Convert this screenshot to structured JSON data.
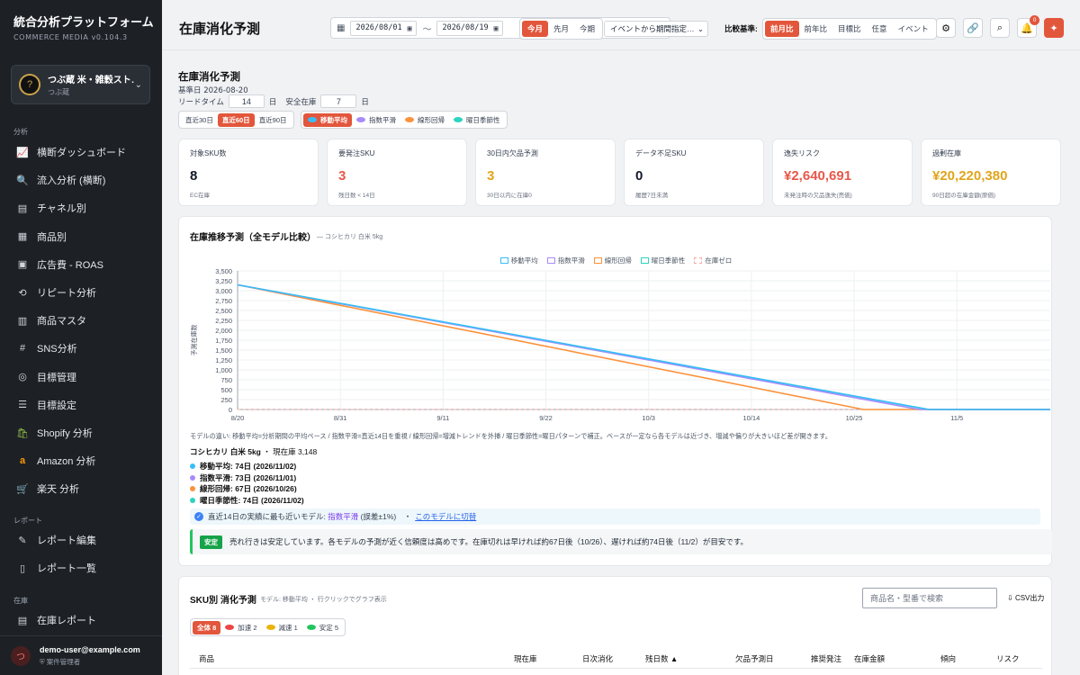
{
  "brand": {
    "title": "統合分析プラットフォーム",
    "subtitle": "COMMERCE MEDIA  v0.104.3"
  },
  "store": {
    "avatar": "?",
    "name": "つぶ蔵 米・雑穀スト…",
    "sub": "つぶ蔵"
  },
  "sidebar": {
    "section_analysis": "分析",
    "items": [
      {
        "label": "横断ダッシュボード",
        "icon": "line-chart-icon",
        "glyph": "📈"
      },
      {
        "label": "流入分析 (横断)",
        "icon": "search-icon",
        "glyph": "🔍"
      },
      {
        "label": "チャネル別",
        "icon": "archive-icon",
        "glyph": "▤"
      },
      {
        "label": "商品別",
        "icon": "boxes-icon",
        "glyph": "▦"
      },
      {
        "label": "広告費 - ROAS",
        "icon": "ad-icon",
        "glyph": "▣"
      },
      {
        "label": "リピート分析",
        "icon": "repeat-icon",
        "glyph": "⟲"
      },
      {
        "label": "商品マスタ",
        "icon": "calendar-icon",
        "glyph": "▥"
      },
      {
        "label": "SNS分析",
        "icon": "hash-icon",
        "glyph": "#"
      },
      {
        "label": "目標管理",
        "icon": "target-icon",
        "glyph": "◎"
      },
      {
        "label": "目標設定",
        "icon": "sliders-icon",
        "glyph": "☰"
      },
      {
        "label": "Shopify 分析",
        "icon": "shopify-icon",
        "glyph": "🛍"
      },
      {
        "label": "Amazon 分析",
        "icon": "amazon-icon",
        "glyph": "a"
      },
      {
        "label": "楽天 分析",
        "icon": "rakuten-cart-icon",
        "glyph": "🛒"
      }
    ],
    "section_report": "レポート",
    "report_items": [
      {
        "label": "レポート編集",
        "icon": "edit-icon",
        "glyph": "✎"
      },
      {
        "label": "レポート一覧",
        "icon": "document-icon",
        "glyph": "▯"
      }
    ],
    "section_stock": "在庫",
    "stock_items": [
      {
        "label": "在庫レポート",
        "icon": "warehouse-icon",
        "glyph": "▤"
      }
    ]
  },
  "user": {
    "avatar": "つ",
    "email": "demo-user@example.com",
    "role": "案件管理者"
  },
  "header": {
    "title": "在庫消化予測",
    "date_from": "2026/08/01",
    "date_to": "2026/08/19",
    "tilde": "〜",
    "period_tabs": [
      "今月",
      "先月",
      "今期"
    ],
    "period_active": 0,
    "event_select": "イベントから期間指定…",
    "compare_label": "比較基準:",
    "compare_tabs": [
      "前月比",
      "前年比",
      "目標比",
      "任意",
      "イベント"
    ],
    "compare_active": 0,
    "notif_count": "0"
  },
  "section": {
    "title": "在庫消化予測",
    "base_date": "基準日 2026-08-20",
    "lead_label": "リードタイム",
    "lead_value": "14",
    "lead_unit": "日",
    "safety_label": "安全在庫",
    "safety_value": "7",
    "safety_unit": "日",
    "range_tabs": [
      "直近30日",
      "直近60日",
      "直近90日"
    ],
    "range_active": 1,
    "model_tabs": [
      {
        "label": "移動平均",
        "color": "#38bdf8"
      },
      {
        "label": "指数平滑",
        "color": "#a78bfa"
      },
      {
        "label": "線形回帰",
        "color": "#fb923c"
      },
      {
        "label": "曜日季節性",
        "color": "#2dd4bf"
      }
    ],
    "model_active": 0
  },
  "kpis": [
    {
      "label": "対象SKU数",
      "value": "8",
      "note": "EC在庫",
      "color": "#111827"
    },
    {
      "label": "要発注SKU",
      "value": "3",
      "note": "残日数 < 14日",
      "color": "#e8584a"
    },
    {
      "label": "30日内欠品予測",
      "value": "3",
      "note": "30日以内に在庫0",
      "color": "#e0a51c"
    },
    {
      "label": "データ不足SKU",
      "value": "0",
      "note": "履歴7日未満",
      "color": "#111827"
    },
    {
      "label": "逸失リスク",
      "value": "¥2,640,691",
      "note": "未発注時の欠品逸失(売価)",
      "color": "#e8584a"
    },
    {
      "label": "過剰在庫",
      "value": "¥20,220,380",
      "note": "90日超の在庫金額(原価)",
      "color": "#e0a51c"
    }
  ],
  "chart_card": {
    "title": "在庫推移予測（全モデル比較）",
    "subtitle": "— コシヒカリ 白米 5kg",
    "description": "モデルの違い: 移動平均=分析期間の平均ペース / 指数平滑=直近14日を重視 / 線形回帰=増減トレンドを外挿 / 曜日季節性=曜日パターンで補正。ペースが一定なら各モデルは近づき、増減や偏りが大きいほど差が開きます。",
    "sku_name": "コシヒカリ 白米 5kg",
    "sku_stock": "・ 現在庫 3,148",
    "model_results": [
      {
        "label": "移動平均: 74日 (2026/11/02)",
        "color": "#38bdf8"
      },
      {
        "label": "指数平滑: 73日 (2026/11/01)",
        "color": "#a78bfa"
      },
      {
        "label": "線形回帰: 67日 (2026/10/26)",
        "color": "#fb923c"
      },
      {
        "label": "曜日季節性: 74日 (2026/11/02)",
        "color": "#2dd4bf"
      }
    ],
    "info_prefix": "直近14日の実績に最も近いモデル:",
    "info_model": "指数平滑",
    "info_suffix": "(誤差±1%)　・",
    "info_link": "このモデルに切替",
    "stable_badge": "安定",
    "stable_text": "売れ行きは安定しています。各モデルの予測が近く信頼度は高めです。在庫切れは早ければ約67日後（10/26）、遅ければ約74日後（11/2）が目安です。"
  },
  "chart_data": {
    "type": "line",
    "title": "在庫推移予測（全モデル比較）",
    "xlabel": "",
    "ylabel": "予測在庫数",
    "ylim": [
      0,
      3500
    ],
    "yticks": [
      "0",
      "250",
      "500",
      "750",
      "1,000",
      "1,250",
      "1,500",
      "1,750",
      "2,000",
      "2,250",
      "2,500",
      "2,750",
      "3,000",
      "3,250",
      "3,500"
    ],
    "xticks": [
      "8/20",
      "8/31",
      "9/11",
      "9/22",
      "10/3",
      "10/14",
      "10/25",
      "11/5"
    ],
    "x_start": "2026-08-20",
    "x_end": "2026-11-15",
    "series": [
      {
        "name": "移動平均",
        "color": "#38bdf8",
        "points": [
          [
            "2026-08-20",
            3148
          ],
          [
            "2026-11-02",
            0
          ],
          [
            "2026-11-15",
            0
          ]
        ]
      },
      {
        "name": "指数平滑",
        "color": "#a78bfa",
        "points": [
          [
            "2026-08-20",
            3148
          ],
          [
            "2026-11-01",
            0
          ],
          [
            "2026-11-15",
            0
          ]
        ]
      },
      {
        "name": "線形回帰",
        "color": "#fb923c",
        "points": [
          [
            "2026-08-20",
            3148
          ],
          [
            "2026-10-26",
            0
          ],
          [
            "2026-11-15",
            0
          ]
        ]
      },
      {
        "name": "曜日季節性",
        "color": "#2dd4bf",
        "points": [
          [
            "2026-08-20",
            3148
          ],
          [
            "2026-11-02",
            0
          ],
          [
            "2026-11-15",
            0
          ]
        ]
      },
      {
        "name": "在庫ゼロ",
        "color": "#f9a8a8",
        "dashed": true,
        "points": [
          [
            "2026-08-20",
            0
          ],
          [
            "2026-11-15",
            0
          ]
        ]
      }
    ],
    "legend": "top-center",
    "grid": true
  },
  "sku_card": {
    "title": "SKU別 消化予測",
    "subtitle": "モデル: 移動平均 ・ 行クリックでグラフ表示",
    "search_placeholder": "商品名・型番で検索",
    "csv": "CSV出力",
    "filters": [
      {
        "label": "全体 8",
        "color": ""
      },
      {
        "label": "加速 2",
        "color": "#ef4444"
      },
      {
        "label": "減速 1",
        "color": "#eab308"
      },
      {
        "label": "安定 5",
        "color": "#22c55e"
      }
    ],
    "columns": [
      "商品",
      "現在庫",
      "日次消化",
      "残日数 ▲",
      "欠品予測日",
      "推奨発注",
      "在庫金額",
      "傾向",
      "リスク"
    ]
  }
}
